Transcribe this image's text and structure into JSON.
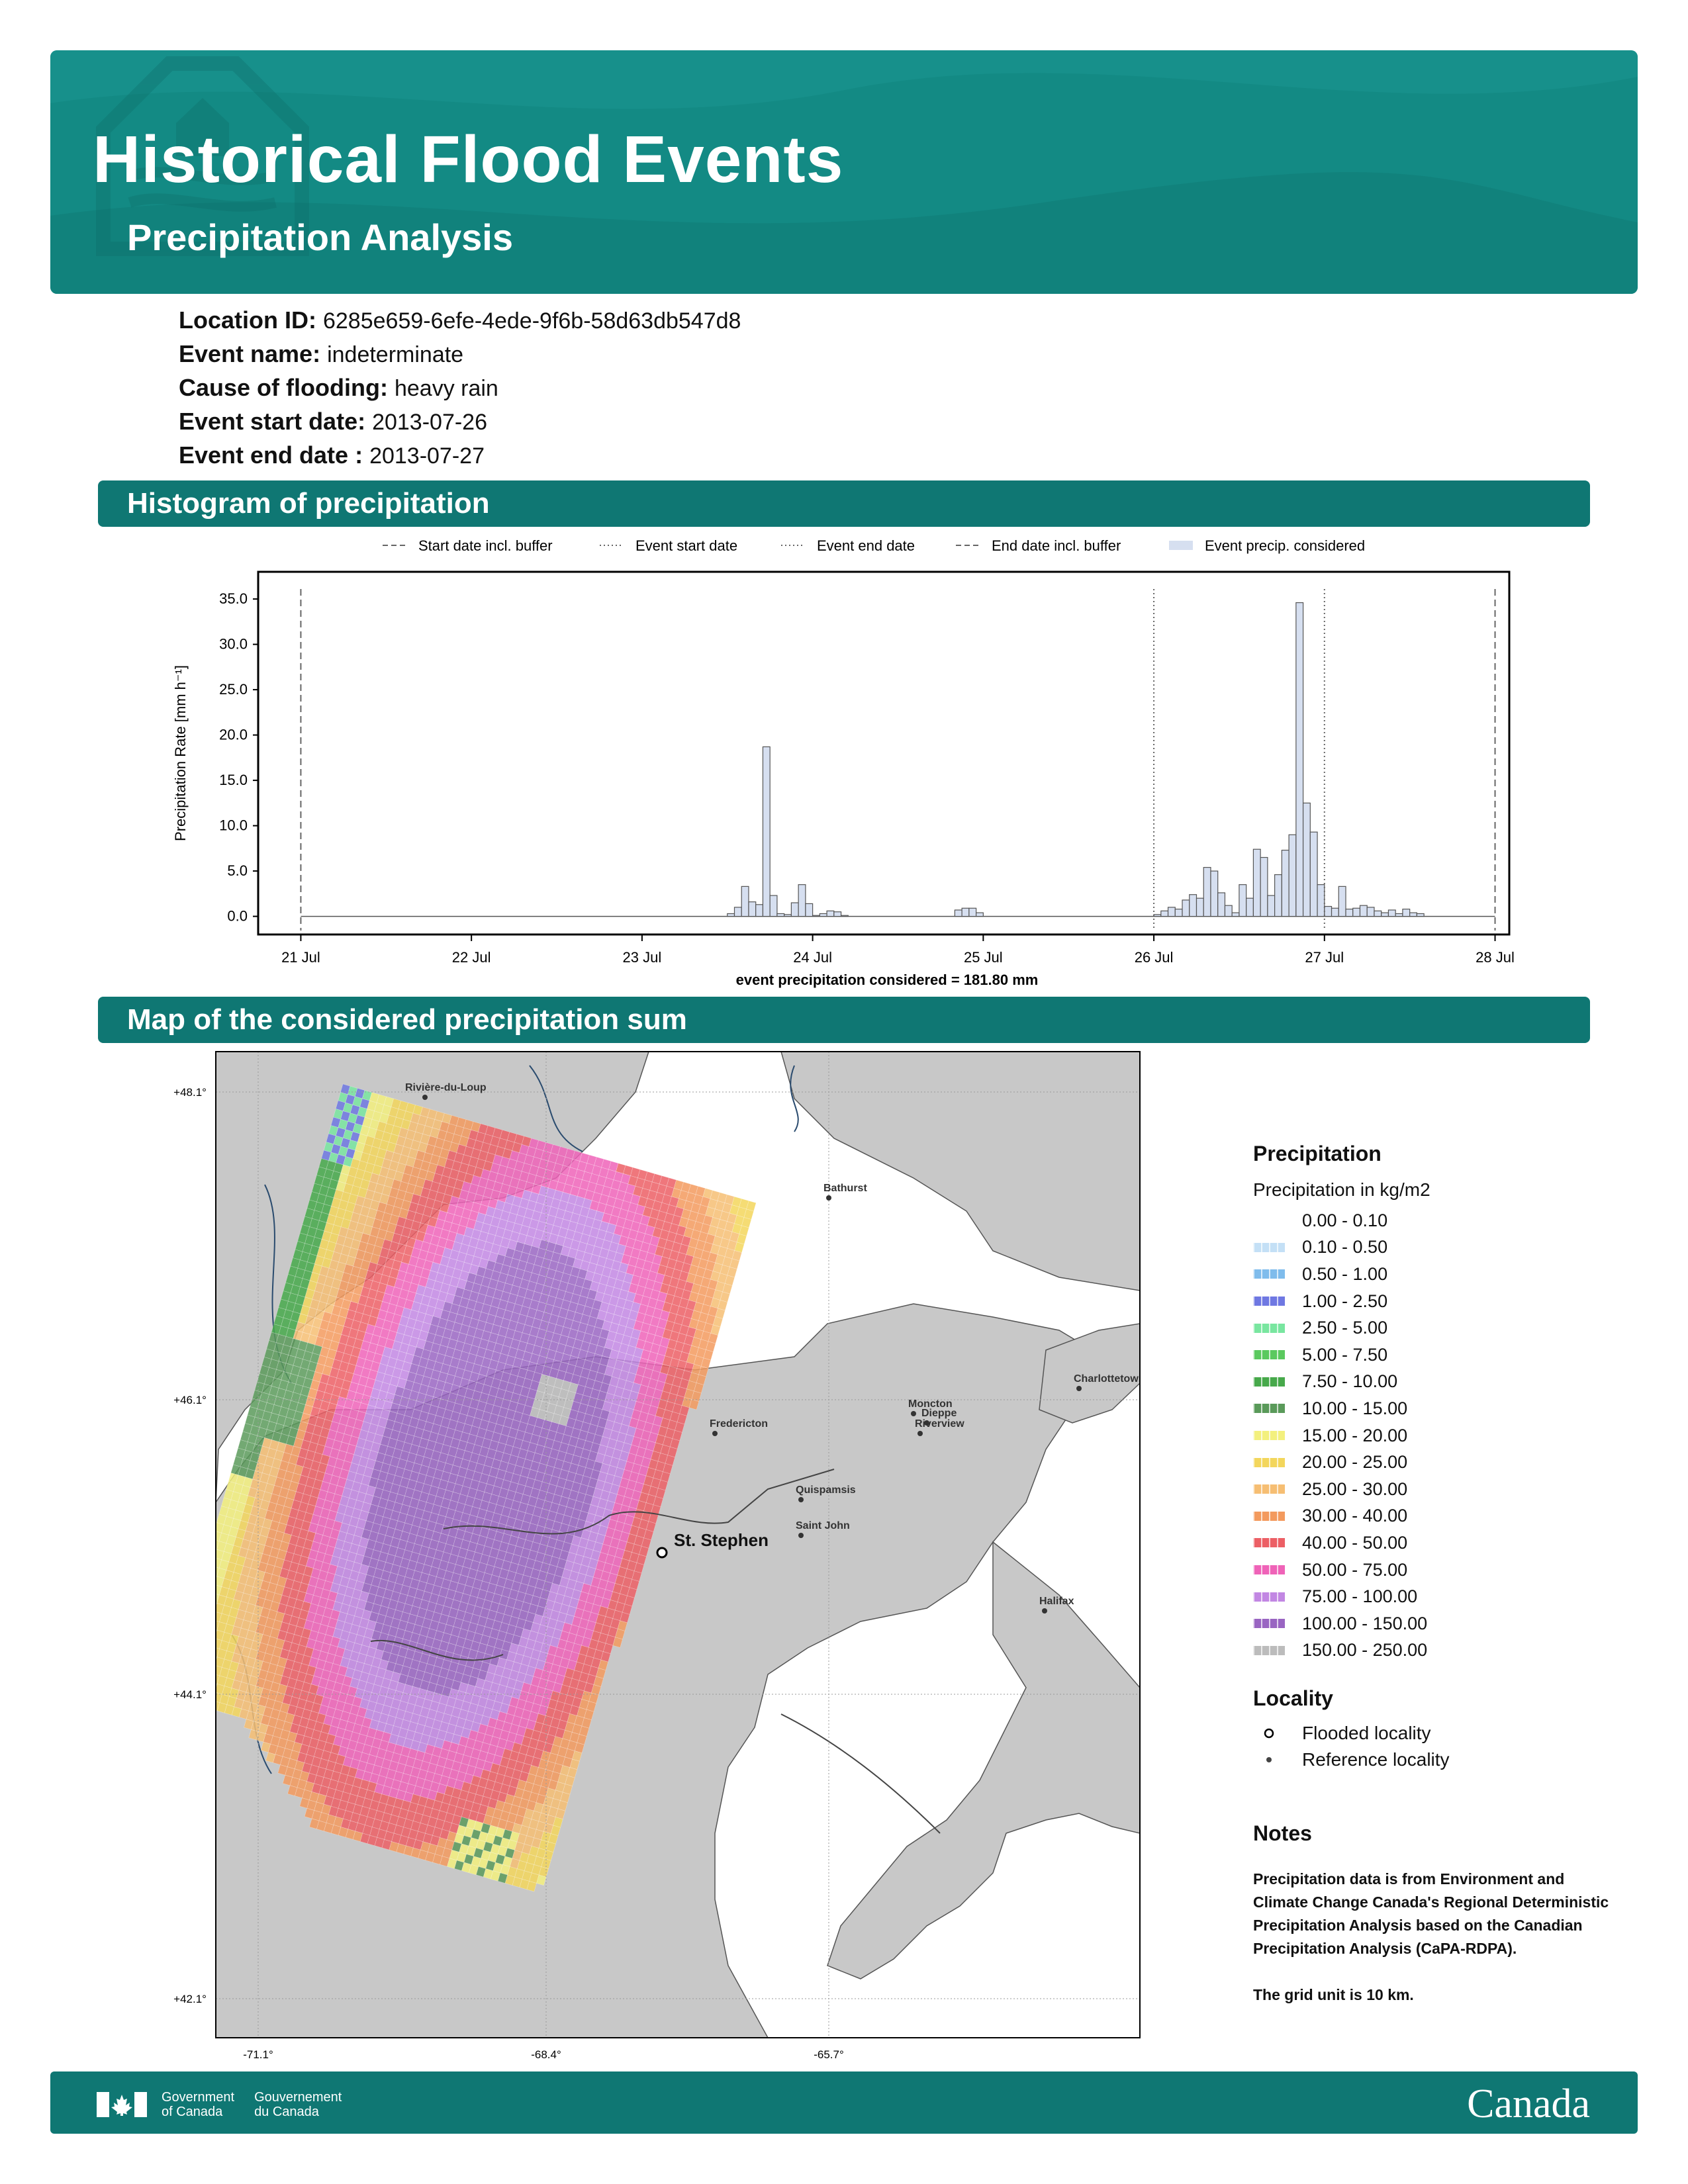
{
  "header": {
    "title": "Historical Flood Events",
    "subtitle": "Precipitation Analysis"
  },
  "event": {
    "location_id_label": "Location ID:",
    "location_id": "6285e659-6efe-4ede-9f6b-58d63db547d8",
    "event_name_label": "Event name:",
    "event_name": "indeterminate",
    "cause_label": "Cause of flooding:",
    "cause": "heavy rain",
    "start_label": "Event start date:",
    "start_date": "2013-07-26",
    "end_label": "Event end date :",
    "end_date": "2013-07-27"
  },
  "sections": {
    "histogram": "Histogram of precipitation",
    "map": "Map of the considered precipitation sum"
  },
  "chart_data": {
    "type": "bar",
    "legend": [
      "Start date incl. buffer",
      "Event start date",
      "Event end date",
      "End date incl. buffer",
      "Event precip. considered"
    ],
    "legend_position": "top",
    "ylabel": "Precipitation Rate [mm h⁻¹]",
    "xlabel": "event precipitation considered = 181.80 mm",
    "xlim": [
      "2013-07-20T18:00",
      "2013-07-28T02:00"
    ],
    "ylim": [
      -2,
      38
    ],
    "yticks": [
      "0.0",
      "5.0",
      "10.0",
      "15.0",
      "20.0",
      "25.0",
      "30.0",
      "35.0"
    ],
    "xticks": [
      "21 Jul",
      "22 Jul",
      "23 Jul",
      "24 Jul",
      "25 Jul",
      "26 Jul",
      "27 Jul",
      "28 Jul"
    ],
    "vlines": {
      "start_incl_buffer": "2013-07-21T00:00",
      "event_start": "2013-07-26T00:00",
      "event_end": "2013-07-27T00:00",
      "end_incl_buffer": "2013-07-28T00:00"
    },
    "series": [
      {
        "name": "Event precip. considered",
        "points": [
          [
            "2013-07-23T12:00",
            0.3
          ],
          [
            "2013-07-23T13:00",
            1.0
          ],
          [
            "2013-07-23T14:00",
            3.3
          ],
          [
            "2013-07-23T15:00",
            1.6
          ],
          [
            "2013-07-23T16:00",
            1.3
          ],
          [
            "2013-07-23T17:00",
            18.7
          ],
          [
            "2013-07-23T18:00",
            2.3
          ],
          [
            "2013-07-23T19:00",
            0.3
          ],
          [
            "2013-07-23T20:00",
            0.2
          ],
          [
            "2013-07-23T21:00",
            1.5
          ],
          [
            "2013-07-23T22:00",
            3.5
          ],
          [
            "2013-07-23T23:00",
            1.4
          ],
          [
            "2013-07-24T00:00",
            0.1
          ],
          [
            "2013-07-24T01:00",
            0.3
          ],
          [
            "2013-07-24T02:00",
            0.6
          ],
          [
            "2013-07-24T03:00",
            0.5
          ],
          [
            "2013-07-24T04:00",
            0.1
          ],
          [
            "2013-07-24T20:00",
            0.7
          ],
          [
            "2013-07-24T21:00",
            0.9
          ],
          [
            "2013-07-24T22:00",
            0.9
          ],
          [
            "2013-07-24T23:00",
            0.4
          ],
          [
            "2013-07-26T00:00",
            0.2
          ],
          [
            "2013-07-26T01:00",
            0.6
          ],
          [
            "2013-07-26T02:00",
            1.0
          ],
          [
            "2013-07-26T03:00",
            0.8
          ],
          [
            "2013-07-26T04:00",
            1.8
          ],
          [
            "2013-07-26T05:00",
            2.4
          ],
          [
            "2013-07-26T06:00",
            2.0
          ],
          [
            "2013-07-26T07:00",
            5.4
          ],
          [
            "2013-07-26T08:00",
            5.0
          ],
          [
            "2013-07-26T09:00",
            2.6
          ],
          [
            "2013-07-26T10:00",
            1.2
          ],
          [
            "2013-07-26T11:00",
            0.4
          ],
          [
            "2013-07-26T12:00",
            3.5
          ],
          [
            "2013-07-26T13:00",
            2.0
          ],
          [
            "2013-07-26T14:00",
            7.4
          ],
          [
            "2013-07-26T15:00",
            6.5
          ],
          [
            "2013-07-26T16:00",
            2.3
          ],
          [
            "2013-07-26T17:00",
            4.6
          ],
          [
            "2013-07-26T18:00",
            7.3
          ],
          [
            "2013-07-26T19:00",
            9.0
          ],
          [
            "2013-07-26T20:00",
            34.6
          ],
          [
            "2013-07-26T21:00",
            12.5
          ],
          [
            "2013-07-26T22:00",
            9.3
          ],
          [
            "2013-07-26T23:00",
            3.5
          ],
          [
            "2013-07-27T00:00",
            1.1
          ],
          [
            "2013-07-27T01:00",
            0.9
          ],
          [
            "2013-07-27T02:00",
            3.3
          ],
          [
            "2013-07-27T03:00",
            0.8
          ],
          [
            "2013-07-27T04:00",
            0.9
          ],
          [
            "2013-07-27T05:00",
            1.2
          ],
          [
            "2013-07-27T06:00",
            1.0
          ],
          [
            "2013-07-27T07:00",
            0.6
          ],
          [
            "2013-07-27T08:00",
            0.4
          ],
          [
            "2013-07-27T09:00",
            0.7
          ],
          [
            "2013-07-27T10:00",
            0.3
          ],
          [
            "2013-07-27T11:00",
            0.8
          ],
          [
            "2013-07-27T12:00",
            0.4
          ],
          [
            "2013-07-27T13:00",
            0.3
          ]
        ]
      }
    ]
  },
  "map": {
    "lat_ticks": [
      "+48.1°",
      "+46.1°",
      "+44.1°",
      "+42.1°"
    ],
    "lon_ticks": [
      "-71.1°",
      "-68.4°",
      "-65.7°"
    ],
    "places": [
      "Rivière-du-Loup",
      "Bathurst",
      "Charlottetown",
      "Moncton",
      "Dieppe",
      "Riverview",
      "Fredericton",
      "Quispamsis",
      "Saint John",
      "Halifax"
    ],
    "flooded_place": "St. Stephen"
  },
  "legend": {
    "title": "Precipitation",
    "subtitle": "Precipitation in kg/m2",
    "classes": [
      {
        "label": "0.00 - 0.10",
        "color": "#ffffff"
      },
      {
        "label": "0.10 - 0.50",
        "color": "#c4e0f6"
      },
      {
        "label": "0.50 - 1.00",
        "color": "#7fbcec"
      },
      {
        "label": "1.00 - 2.50",
        "color": "#6f78e2"
      },
      {
        "label": "2.50 - 5.00",
        "color": "#79e6a0"
      },
      {
        "label": "5.00 - 7.50",
        "color": "#5bc95f"
      },
      {
        "label": "7.50 - 10.00",
        "color": "#47a94b"
      },
      {
        "label": "10.00 - 15.00",
        "color": "#5a9a5a"
      },
      {
        "label": "15.00 - 20.00",
        "color": "#f3f07e"
      },
      {
        "label": "20.00 - 25.00",
        "color": "#f3d65c"
      },
      {
        "label": "25.00 - 30.00",
        "color": "#f6be73"
      },
      {
        "label": "30.00 - 40.00",
        "color": "#f39a5e"
      },
      {
        "label": "40.00 - 50.00",
        "color": "#ec5f65"
      },
      {
        "label": "50.00 - 75.00",
        "color": "#ef63b8"
      },
      {
        "label": "75.00 - 100.00",
        "color": "#c287e3"
      },
      {
        "label": "100.00 - 150.00",
        "color": "#9965c2"
      },
      {
        "label": "150.00 - 250.00",
        "color": "#bcbcbc"
      }
    ],
    "locality_title": "Locality",
    "locality_items": [
      "Flooded locality",
      "Reference locality"
    ]
  },
  "notes": {
    "title": "Notes",
    "paragraphs": [
      "Precipitation data is from Environment and Climate Change Canada's Regional Deterministic Precipitation Analysis based on the Canadian Precipitation Analysis (CaPA-RDPA).",
      "The grid unit is 10 km."
    ]
  },
  "footer": {
    "gov_en_1": "Government",
    "gov_en_2": "of Canada",
    "gov_fr_1": "Gouvernement",
    "gov_fr_2": "du Canada",
    "wordmark": "Canada"
  }
}
